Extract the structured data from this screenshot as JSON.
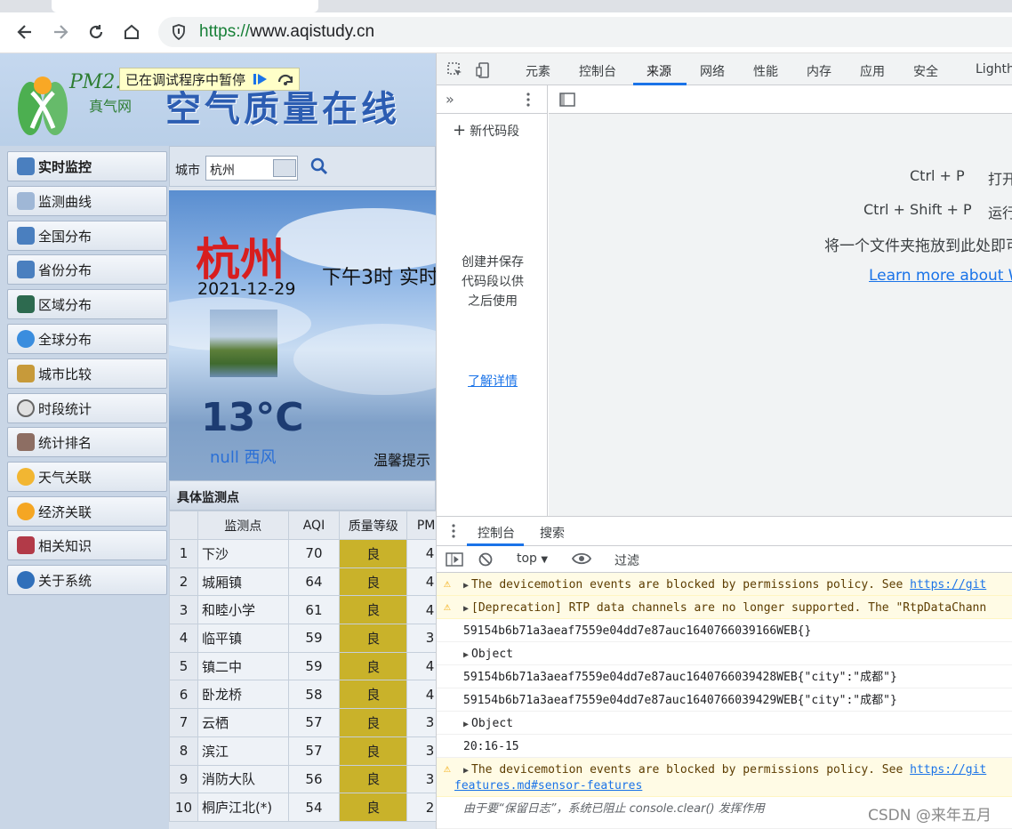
{
  "browser": {
    "url_scheme": "https://",
    "url_rest": "www.aqistudy.cn"
  },
  "site": {
    "logo_text": "PM2.5",
    "logo_sub": "真气网",
    "banner_title": "空气质量在线",
    "paused_label": "已在调试程序中暂停",
    "nav": [
      "实时监控",
      "监测曲线",
      "全国分布",
      "省份分布",
      "区域分布",
      "全球分布",
      "城市比较",
      "时段统计",
      "统计排名",
      "天气关联",
      "经济关联",
      "相关知识",
      "关于系统"
    ],
    "city_label": "城市",
    "city_value": "杭州",
    "weather": {
      "city": "杭州",
      "date": "2021-12-29",
      "time": "下午3时 实时",
      "temp": "13°C",
      "wind": "null 西风",
      "tip": "温馨提示"
    },
    "stations_title": "具体监测点",
    "table_headers": [
      "",
      "监测点",
      "AQI",
      "质量等级",
      "PM2"
    ],
    "rows": [
      [
        "1",
        "下沙",
        "70",
        "良",
        "4"
      ],
      [
        "2",
        "城厢镇",
        "64",
        "良",
        "4"
      ],
      [
        "3",
        "和睦小学",
        "61",
        "良",
        "4"
      ],
      [
        "4",
        "临平镇",
        "59",
        "良",
        "3"
      ],
      [
        "5",
        "镇二中",
        "59",
        "良",
        "4"
      ],
      [
        "6",
        "卧龙桥",
        "58",
        "良",
        "4"
      ],
      [
        "7",
        "云栖",
        "57",
        "良",
        "3"
      ],
      [
        "8",
        "滨江",
        "57",
        "良",
        "3"
      ],
      [
        "9",
        "消防大队",
        "56",
        "良",
        "3"
      ],
      [
        "10",
        "桐庐江北(*)",
        "54",
        "良",
        "2"
      ]
    ]
  },
  "devtools": {
    "tabs": [
      "元素",
      "控制台",
      "来源",
      "网络",
      "性能",
      "内存",
      "应用",
      "安全",
      "Lighth"
    ],
    "new_snippet": "新代码段",
    "snippet_help": "创建并保存代码段以供之后使用",
    "snippet_link": "了解详情",
    "shortcuts": [
      {
        "key": "Ctrl + P",
        "desc": "打开"
      },
      {
        "key": "Ctrl + Shift + P",
        "desc": "运行"
      }
    ],
    "drop_text": "将一个文件夹拖放到此处即可",
    "learn_more": "Learn more about Wo",
    "drawer_tabs": [
      "控制台",
      "搜索"
    ],
    "context": "top",
    "filter_placeholder": "过滤",
    "messages": [
      {
        "type": "warn",
        "text": "The devicemotion events are blocked by permissions policy. See ",
        "link": "https://git"
      },
      {
        "type": "warn",
        "text": "[Deprecation] RTP data channels are no longer supported. The \"RtpDataChann"
      },
      {
        "type": "log",
        "text": "59154b6b71a3aeaf7559e04dd7e87auc1640766039166WEB{}"
      },
      {
        "type": "obj",
        "text": "Object"
      },
      {
        "type": "log",
        "text": "59154b6b71a3aeaf7559e04dd7e87auc1640766039428WEB{\"city\":\"成都\"}"
      },
      {
        "type": "log",
        "text": "59154b6b71a3aeaf7559e04dd7e87auc1640766039429WEB{\"city\":\"成都\"}"
      },
      {
        "type": "obj",
        "text": "Object"
      },
      {
        "type": "log",
        "text": "20:16-15"
      },
      {
        "type": "warn2",
        "text": "The devicemotion events are blocked by permissions policy. See ",
        "link": "https://git",
        "line2": "features.md#sensor-features"
      },
      {
        "type": "info",
        "text": "由于要“保留日志”，系统已阻止 console.clear() 发挥作用"
      }
    ]
  },
  "watermark": "CSDN @来年五月"
}
